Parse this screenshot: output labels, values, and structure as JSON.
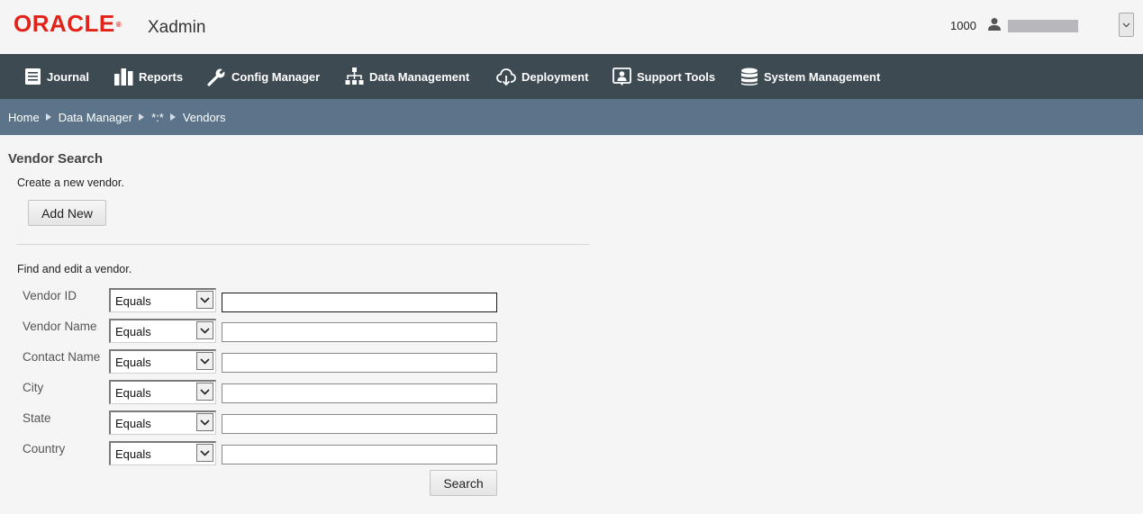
{
  "header": {
    "logo": "ORACLE",
    "logo_mark": "®",
    "app_title": "Xadmin",
    "store_number": "1000",
    "user_icon": "user-icon",
    "menu_icon": "chevron-down-icon"
  },
  "nav": {
    "items": [
      {
        "label": "Journal",
        "icon": "journal-icon"
      },
      {
        "label": "Reports",
        "icon": "bar-chart-icon"
      },
      {
        "label": "Config Manager",
        "icon": "wrench-icon"
      },
      {
        "label": "Data Management",
        "icon": "hierarchy-icon"
      },
      {
        "label": "Deployment",
        "icon": "cloud-download-icon"
      },
      {
        "label": "Support Tools",
        "icon": "support-icon"
      },
      {
        "label": "System Management",
        "icon": "database-icon"
      }
    ]
  },
  "breadcrumb": {
    "items": [
      "Home",
      "Data Manager",
      "*:*",
      "Vendors"
    ]
  },
  "page": {
    "title": "Vendor Search",
    "create_text": "Create a new vendor.",
    "add_new_label": "Add New",
    "find_text": "Find and edit a vendor.",
    "search_label": "Search",
    "fields": [
      {
        "label": "Vendor ID",
        "operator": "Equals",
        "value": ""
      },
      {
        "label": "Vendor Name",
        "operator": "Equals",
        "value": ""
      },
      {
        "label": "Contact Name",
        "operator": "Equals",
        "value": ""
      },
      {
        "label": "City",
        "operator": "Equals",
        "value": ""
      },
      {
        "label": "State",
        "operator": "Equals",
        "value": ""
      },
      {
        "label": "Country",
        "operator": "Equals",
        "value": ""
      }
    ]
  },
  "colors": {
    "brand_red": "#e2231a",
    "nav_bg": "#3e4a52",
    "breadcrumb_bg": "#5c748a",
    "page_bg": "#f5f5f5"
  }
}
